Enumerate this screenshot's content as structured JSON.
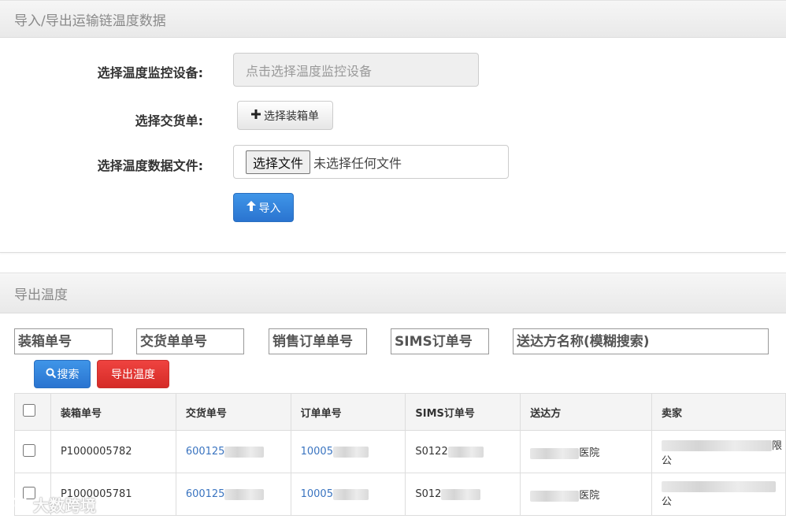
{
  "import_panel": {
    "title": "导入/导出运输链温度数据",
    "device_label": "选择温度监控设备:",
    "device_placeholder": "点击选择温度监控设备",
    "delivery_label": "选择交货单:",
    "select_packing_button": "选择装箱单",
    "file_label": "选择温度数据文件:",
    "file_button": "选择文件",
    "file_status": "未选择任何文件",
    "import_button": "导入"
  },
  "export_panel": {
    "title": "导出温度",
    "filters": {
      "packing_no": "装箱单号",
      "delivery_no": "交货单单号",
      "sales_order_no": "销售订单单号",
      "sims_order_no": "SIMS订单号",
      "recipient_name": "送达方名称(模糊搜索)"
    },
    "search_button": "搜索",
    "export_button": "导出温度"
  },
  "table": {
    "columns": [
      "装箱单号",
      "交货单号",
      "订单单号",
      "SIMS订单号",
      "送达方",
      "卖家"
    ],
    "rows": [
      {
        "packing_no": "P1000005782",
        "delivery_no": "600125",
        "order_no": "10005",
        "sims_no": "S0122",
        "recipient_suffix": "医院",
        "seller_suffix": "限公"
      },
      {
        "packing_no": "P1000005781",
        "delivery_no": "600125",
        "order_no": "10005",
        "sims_no": "S012",
        "recipient_suffix": "医院",
        "seller_suffix": "公"
      }
    ]
  },
  "watermark": "大数跨境",
  "colors": {
    "primary": "#2a74d0",
    "danger": "#d52b27",
    "link": "#3a74c0"
  }
}
